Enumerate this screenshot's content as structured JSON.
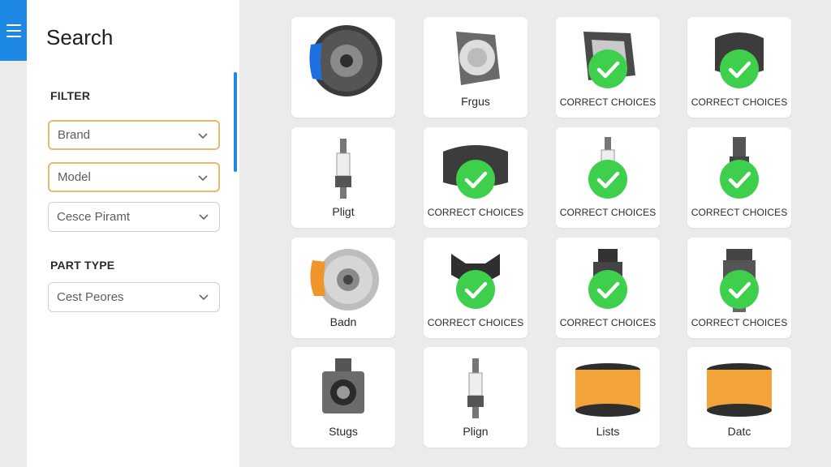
{
  "sidebar": {
    "title": "Search",
    "filter_label": "FILTER",
    "brand_select": {
      "value": "Brand"
    },
    "model_select": {
      "value": "Model"
    },
    "third_select": {
      "value": "Cesce Piramt"
    },
    "part_type_label": "PART TYPE",
    "part_type_select": {
      "value": "Cest Peores"
    }
  },
  "cards": [
    {
      "label": "",
      "icon": "brake-rotor-blue-icon",
      "checked": false
    },
    {
      "label": "Frgus",
      "icon": "headlight-icon",
      "checked": false
    },
    {
      "label": "CORRECT CHOICES",
      "icon": "light-housing-icon",
      "checked": true
    },
    {
      "label": "CORRECT CHOICES",
      "icon": "brake-pad-icon",
      "checked": true
    },
    {
      "label": "Pligt",
      "icon": "spark-plug-icon",
      "checked": false
    },
    {
      "label": "CORRECT CHOICES",
      "icon": "brake-pad-icon",
      "checked": true
    },
    {
      "label": "CORRECT CHOICES",
      "icon": "spark-plug-icon",
      "checked": true
    },
    {
      "label": "CORRECT CHOICES",
      "icon": "ignition-coil-icon",
      "checked": true
    },
    {
      "label": "Badn",
      "icon": "brake-rotor-orange-icon",
      "checked": false
    },
    {
      "label": "CORRECT CHOICES",
      "icon": "engine-mount-icon",
      "checked": true
    },
    {
      "label": "CORRECT CHOICES",
      "icon": "sensor-icon",
      "checked": true
    },
    {
      "label": "CORRECT CHOICES",
      "icon": "strut-mount-icon",
      "checked": true
    },
    {
      "label": "Stugs",
      "icon": "wheel-bearing-icon",
      "checked": false
    },
    {
      "label": "Plign",
      "icon": "spark-plug-icon",
      "checked": false
    },
    {
      "label": "Lists",
      "icon": "oil-filter-icon",
      "checked": false
    },
    {
      "label": "Datc",
      "icon": "oil-filter-icon",
      "checked": false
    }
  ],
  "colors": {
    "accent": "#1e88e5",
    "check": "#3ecf4c",
    "active_border": "#eab86e"
  }
}
